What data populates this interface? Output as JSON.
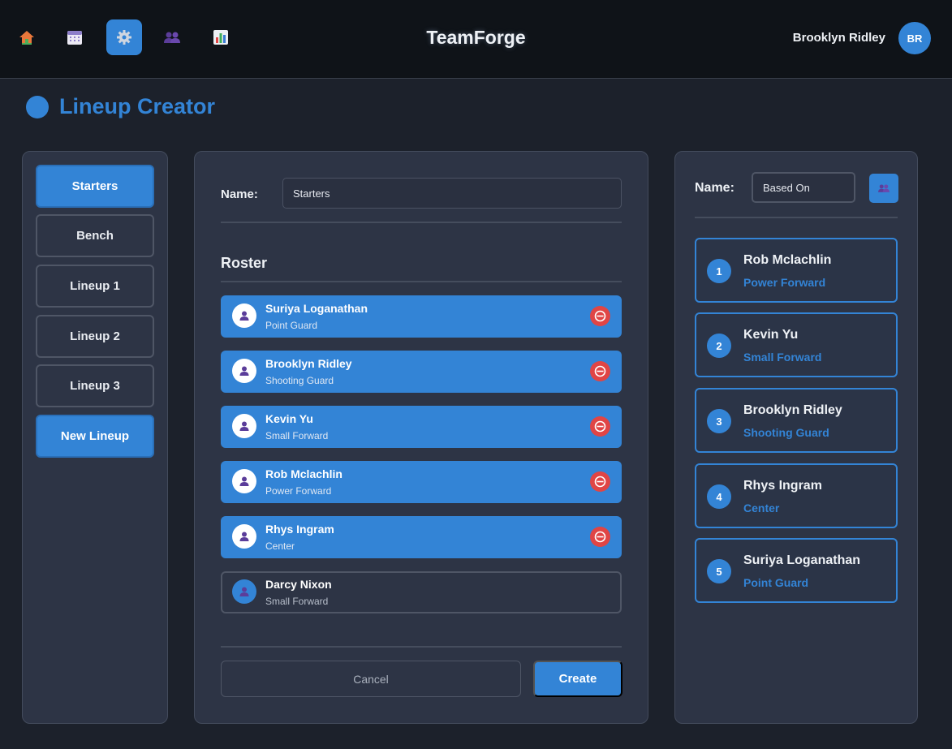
{
  "app": {
    "title": "TeamForge",
    "user_name": "Brooklyn Ridley",
    "user_initials": "BR"
  },
  "nav": {
    "items": [
      {
        "icon": "home-icon",
        "active": false
      },
      {
        "icon": "calendar-icon",
        "active": false
      },
      {
        "icon": "gear-icon",
        "active": true
      },
      {
        "icon": "people-icon",
        "active": false
      },
      {
        "icon": "bar-chart-icon",
        "active": false
      }
    ]
  },
  "page": {
    "title": "Lineup Creator"
  },
  "sidebar": {
    "items": [
      {
        "label": "Starters",
        "active": true
      },
      {
        "label": "Bench",
        "active": false
      },
      {
        "label": "Lineup 1",
        "active": false
      },
      {
        "label": "Lineup 2",
        "active": false
      },
      {
        "label": "Lineup 3",
        "active": false
      },
      {
        "label": "New Lineup",
        "active": true
      }
    ]
  },
  "editor": {
    "name_label": "Name:",
    "name_value": "Starters",
    "roster_title": "Roster",
    "roster": [
      {
        "name": "Suriya Loganathan",
        "position": "Point Guard",
        "selected": true
      },
      {
        "name": "Brooklyn Ridley",
        "position": "Shooting Guard",
        "selected": true
      },
      {
        "name": "Kevin Yu",
        "position": "Small Forward",
        "selected": true
      },
      {
        "name": "Rob Mclachlin",
        "position": "Power Forward",
        "selected": true
      },
      {
        "name": "Rhys Ingram",
        "position": "Center",
        "selected": true
      },
      {
        "name": "Darcy Nixon",
        "position": "Small Forward",
        "selected": false
      }
    ],
    "cancel_label": "Cancel",
    "create_label": "Create"
  },
  "preview": {
    "name_label": "Name:",
    "name_value": "Based On",
    "lineup": [
      {
        "number": "1",
        "name": "Rob Mclachlin",
        "position": "Power Forward"
      },
      {
        "number": "2",
        "name": "Kevin Yu",
        "position": "Small Forward"
      },
      {
        "number": "3",
        "name": "Brooklyn Ridley",
        "position": "Shooting Guard"
      },
      {
        "number": "4",
        "name": "Rhys Ingram",
        "position": "Center"
      },
      {
        "number": "5",
        "name": "Suriya Loganathan",
        "position": "Point Guard"
      }
    ]
  },
  "colors": {
    "accent": "#3384d6",
    "danger": "#e04545",
    "background": "#1c212b",
    "panel": "#2d3445",
    "topbar": "#0f1318"
  }
}
